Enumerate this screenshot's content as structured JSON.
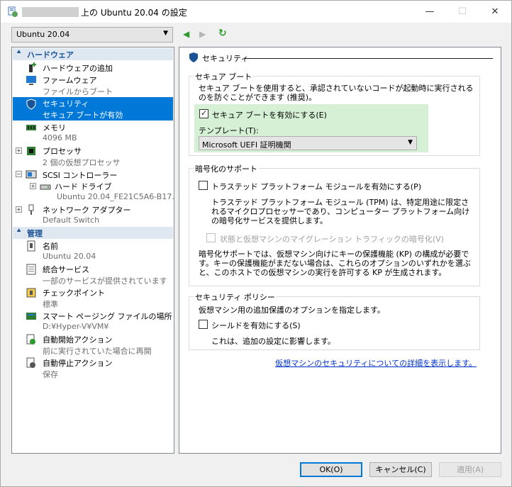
{
  "window": {
    "title": "上の Ubuntu 20.04 の設定",
    "minimize_glyph": "—",
    "maximize_glyph": "☐",
    "close_glyph": "✕"
  },
  "vm_selector": {
    "value": "Ubuntu 20.04"
  },
  "nav": {
    "back": "◀",
    "forward": "▶",
    "refresh": "↻"
  },
  "sidebar": {
    "hardware_header": "ハードウェア",
    "hardware_items": [
      {
        "label": "ハードウェアの追加",
        "icon": "add-hardware-icon"
      },
      {
        "label": "ファームウェア",
        "sub": "ファイルからブート",
        "icon": "firmware-icon"
      },
      {
        "label": "セキュリティ",
        "sub": "セキュア ブートが有効",
        "icon": "shield-icon",
        "selected": true
      },
      {
        "label": "メモリ",
        "sub": "4096 MB",
        "icon": "memory-icon"
      },
      {
        "label": "プロセッサ",
        "sub": "2 個の仮想プロセッサ",
        "icon": "processor-icon"
      },
      {
        "label": "SCSI コントローラー",
        "icon": "scsi-controller-icon"
      },
      {
        "label": "ハード ドライブ",
        "sub": "Ubuntu 20.04_FE21C5A6-B17...",
        "icon": "hard-drive-icon"
      },
      {
        "label": "ネットワーク アダプター",
        "sub": "Default Switch",
        "icon": "network-adapter-icon"
      }
    ],
    "management_header": "管理",
    "management_items": [
      {
        "label": "名前",
        "sub": "Ubuntu 20.04",
        "icon": "name-icon"
      },
      {
        "label": "統合サービス",
        "sub": "一部のサービスが提供されています",
        "icon": "integration-services-icon"
      },
      {
        "label": "チェックポイント",
        "sub": "標準",
        "icon": "checkpoint-icon"
      },
      {
        "label": "スマート ページング ファイルの場所",
        "sub": "D:¥Hyper-V¥VM¥",
        "icon": "smart-paging-icon"
      },
      {
        "label": "自動開始アクション",
        "sub": "前に実行されていた場合に再開",
        "icon": "auto-start-icon"
      },
      {
        "label": "自動停止アクション",
        "sub": "保存",
        "icon": "auto-stop-icon"
      }
    ]
  },
  "content": {
    "page_title": "セキュリティ",
    "secure_boot": {
      "group_title": "セキュア ブート",
      "description": "セキュア ブートを使用すると、承認されていないコードが起動時に実行されるのを防ぐことができます (推奨)。",
      "checkbox_label": "セキュア ブートを有効にする(E)",
      "checked": true,
      "template_label": "テンプレート(T):",
      "template_value": "Microsoft UEFI 証明機関"
    },
    "encryption": {
      "group_title": "暗号化のサポート",
      "tpm_checkbox_label": "トラステッド プラットフォーム モジュールを有効にする(P)",
      "tpm_checked": false,
      "tpm_description": "トラステッド プラットフォーム モジュール (TPM) は、特定用途に限定されるマイクロプロセッサーであり、コンピューター プラットフォーム向けの暗号化サービスを提供します。",
      "migration_checkbox_label": "状態と仮想マシンのマイグレーション トラフィックの暗号化(V)",
      "migration_enabled": false,
      "kp_description": "暗号化サポートでは、仮想マシン向けにキーの保護機能 (KP) の構成が必要です。キーの保護機能がまだない場合は、これらのオプションのいずれかを選ぶと、このホストでの仮想マシンの実行を許可する KP が生成されます。"
    },
    "security_policy": {
      "group_title": "セキュリティ ポリシー",
      "description": "仮想マシン用の追加保護のオプションを指定します。",
      "shield_checkbox_label": "シールドを有効にする(S)",
      "shield_checked": false,
      "shield_note": "これは、追加の設定に影響します。"
    },
    "details_link": "仮想マシンのセキュリティについての詳細を表示します。"
  },
  "buttons": {
    "ok": "OK(O)",
    "cancel": "キャンセル(C)",
    "apply": "適用(A)"
  },
  "colors": {
    "selection": "#0078d7",
    "secure_boot_highlight": "#d5f0d5",
    "link": "#0033cc",
    "section_header": "#1a5296"
  }
}
